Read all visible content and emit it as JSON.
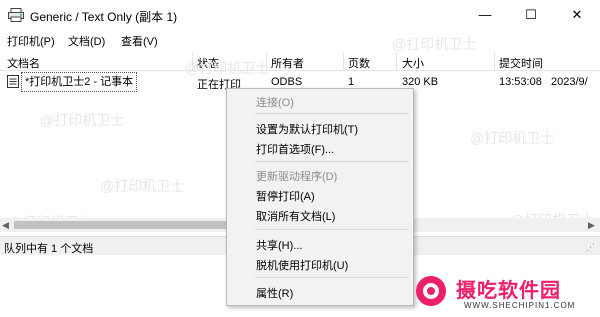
{
  "window": {
    "title": "Generic / Text Only (副本 1)",
    "controls": {
      "minimize": "—",
      "maximize": "☐",
      "close": "✕"
    }
  },
  "menu": [
    "打印机(P)",
    "文档(D)",
    "查看(V)"
  ],
  "columns": [
    "文档名",
    "状态",
    "所有者",
    "页数",
    "大小",
    "提交时间"
  ],
  "jobs": [
    {
      "name": "*打印机卫士2 - 记事本",
      "status": "正在打印",
      "owner": "ODBS",
      "pages": "1",
      "size": "320 KB",
      "time": "13:53:08",
      "date": "2023/9/"
    }
  ],
  "status_text": "队列中有 1 个文档",
  "context_menu": [
    {
      "label": "连接(O)",
      "enabled": false
    },
    {
      "label": "设置为默认打印机(T)",
      "enabled": true
    },
    {
      "label": "打印首选项(F)...",
      "enabled": true
    },
    {
      "label": "更新驱动程序(D)",
      "enabled": false
    },
    {
      "label": "暂停打印(A)",
      "enabled": true
    },
    {
      "label": "取消所有文档(L)",
      "enabled": true
    },
    {
      "label": "共享(H)...",
      "enabled": true
    },
    {
      "label": "脱机使用打印机(U)",
      "enabled": true
    },
    {
      "label": "属性(R)",
      "enabled": true
    }
  ],
  "watermark": "@打印机卫士",
  "logo": {
    "name": "摄吃软件园",
    "url": "WWW.SHECHIPIN1.COM"
  },
  "colors": {
    "logo_pink": "#ec1f6a",
    "menu_bg": "#f2f2f2",
    "status_bg": "#f0f0f0"
  }
}
